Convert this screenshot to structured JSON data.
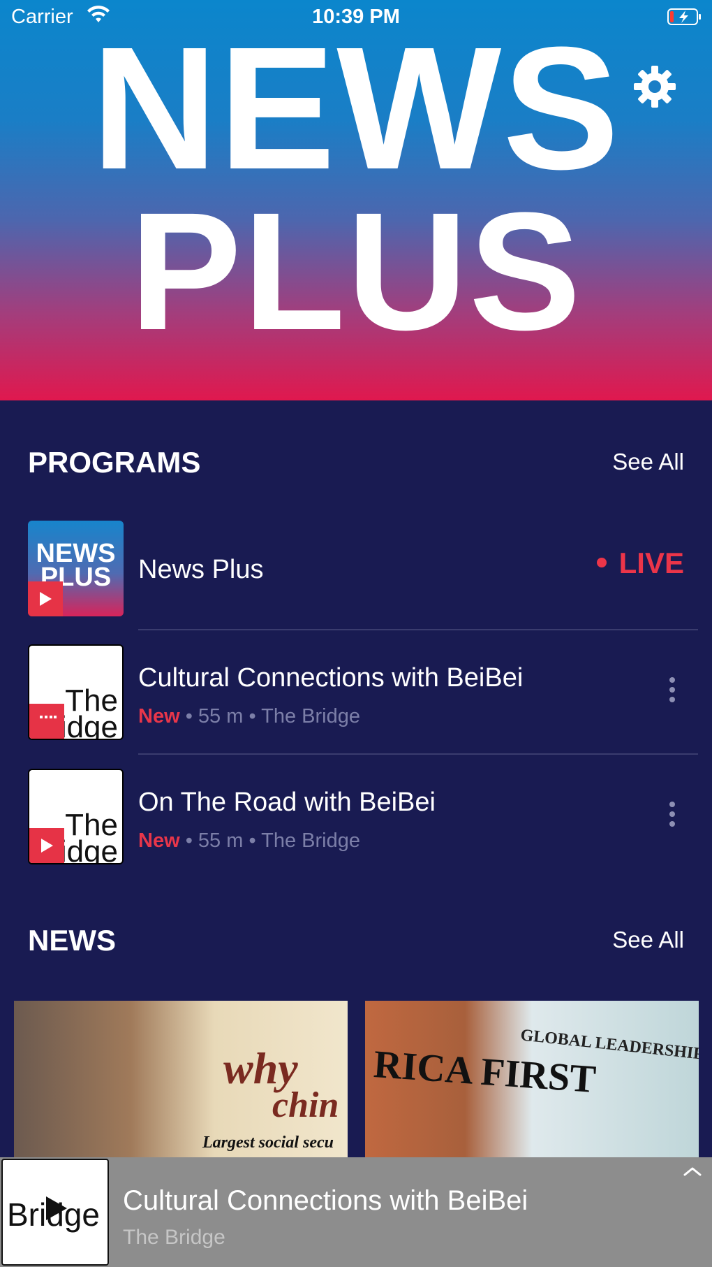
{
  "status_bar": {
    "carrier": "Carrier",
    "time": "10:39 PM"
  },
  "hero": {
    "line1": "NEWS",
    "line2": "PLUS"
  },
  "programs": {
    "title": "PROGRAMS",
    "see_all": "See All",
    "items": [
      {
        "thumb_text": "NEWS PLUS",
        "title": "News Plus",
        "live": "LIVE"
      },
      {
        "thumb_text": "The Bridge",
        "title": "Cultural Connections with BeiBei",
        "badge": "New",
        "duration": "55 m",
        "show": "The Bridge"
      },
      {
        "thumb_text": "The Bridge",
        "title": "On The Road with BeiBei",
        "badge": "New",
        "duration": "55 m",
        "show": "The Bridge"
      }
    ]
  },
  "news": {
    "title": "NEWS",
    "see_all": "See All",
    "cards": [
      {
        "text1": "why",
        "text2": "chin",
        "caption": "Largest social secu"
      },
      {
        "text1": "RICA FIRST",
        "text2": "GLOBAL LEADERSHIP"
      }
    ]
  },
  "player": {
    "thumb_text": "Bridge",
    "title": "Cultural Connections with BeiBei",
    "subtitle": "The Bridge"
  },
  "colors": {
    "background": "#191b52",
    "accent_red": "#ec3549",
    "player_bar": "#8d8d8d"
  }
}
